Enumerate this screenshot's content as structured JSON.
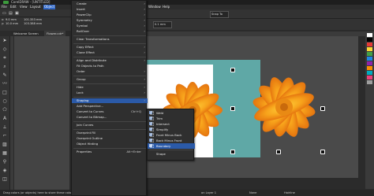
{
  "window": {
    "title": "CorelDRAW - [UNTITLED]"
  },
  "menubar": {
    "items": [
      "File",
      "Edit",
      "View",
      "Layout",
      "Object"
    ],
    "active_index": 4
  },
  "property_bar": {
    "x_value": "9.0 mm",
    "y_value": "10.0 mm",
    "w_value": "101.353 mm",
    "h_value": "103.388 mm",
    "zoom": "Snap To",
    "outline_width": "0.1 mm"
  },
  "doc_tabs": [
    "Welcome Screen",
    "Flower.cdr*"
  ],
  "object_menu": {
    "items": [
      {
        "label": "Create",
        "submenu": true
      },
      {
        "label": "Insert",
        "submenu": true
      },
      {
        "label": "PowerClip",
        "submenu": true
      },
      {
        "label": "Symmetry",
        "submenu": true
      },
      {
        "label": "Symbol",
        "submenu": true
      },
      {
        "label": "RollOver",
        "submenu": true
      },
      {
        "sep": true
      },
      {
        "label": "Clear Transformations"
      },
      {
        "sep": true
      },
      {
        "label": "Copy Effect",
        "submenu": true
      },
      {
        "label": "Clone Effect",
        "submenu": true
      },
      {
        "sep": true
      },
      {
        "label": "Align and Distribute",
        "submenu": true
      },
      {
        "label": "Fit Objects to Path"
      },
      {
        "label": "Order",
        "submenu": true
      },
      {
        "sep": true
      },
      {
        "label": "Group",
        "submenu": true
      },
      {
        "sep": true
      },
      {
        "label": "Hide",
        "submenu": true
      },
      {
        "label": "Lock",
        "submenu": true
      },
      {
        "sep": true
      },
      {
        "label": "Shaping",
        "submenu": true,
        "highlighted": true
      },
      {
        "label": "Add Perspective..."
      },
      {
        "label": "Convert to Curves",
        "shortcut": "Ctrl+Q"
      },
      {
        "label": "Convert to Bitmap..."
      },
      {
        "sep": true
      },
      {
        "label": "Join Curves"
      },
      {
        "sep": true
      },
      {
        "label": "Overprint Fill"
      },
      {
        "label": "Overprint Outline"
      },
      {
        "label": "Object Hinting"
      },
      {
        "sep": true
      },
      {
        "label": "Properties",
        "shortcut": "Alt+Enter"
      }
    ]
  },
  "shaping_submenu": {
    "items": [
      {
        "label": "Weld",
        "icon": "weld-icon"
      },
      {
        "label": "Trim",
        "icon": "trim-icon"
      },
      {
        "label": "Intersect",
        "icon": "intersect-icon"
      },
      {
        "label": "Simplify",
        "icon": "simplify-icon"
      },
      {
        "label": "Front Minus Back",
        "icon": "front-minus-back-icon"
      },
      {
        "label": "Back Minus Front",
        "icon": "back-minus-front-icon"
      },
      {
        "label": "Boundary",
        "icon": "boundary-icon",
        "highlighted": true
      },
      {
        "sep": true
      },
      {
        "label": "Shape",
        "icon": ""
      }
    ]
  },
  "status": {
    "left": "Drag colors (or objects) here to store these colors with your document",
    "layer": "on Layer 1",
    "fill": "None",
    "outline": "Hairline"
  },
  "colors": {
    "accent": "#2b5aa8",
    "petal": "#f7a21b",
    "photo_bg": "#5fa8a6"
  }
}
